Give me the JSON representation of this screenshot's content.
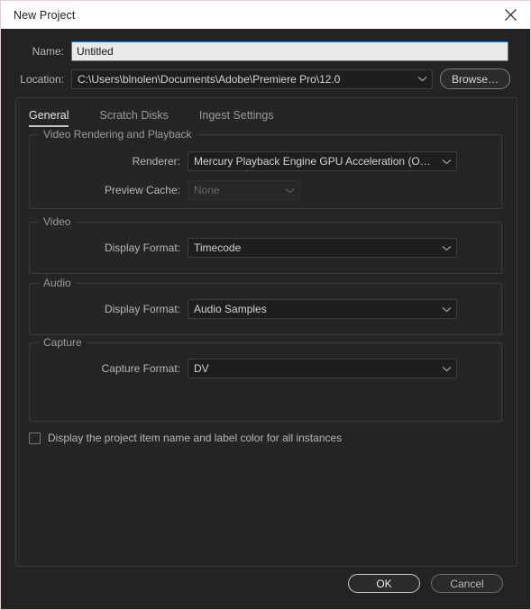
{
  "window": {
    "title": "New Project",
    "close_icon": "close-icon",
    "border_color": "#e3cfcf",
    "titlebar_bg": "#ffffff",
    "body_bg": "#232323",
    "panel_bg": "#252525",
    "accent_focus": "#2f7fd0"
  },
  "form": {
    "name": {
      "label": "Name:",
      "value": "Untitled",
      "placeholder": "Untitled"
    },
    "location": {
      "label": "Location:",
      "value": "C:\\Users\\blnolen\\Documents\\Adobe\\Premiere Pro\\12.0",
      "chevron_icon": "chevron-down-icon"
    },
    "browse": {
      "label": "Browse…"
    }
  },
  "tabs": [
    {
      "label": "General",
      "active": true
    },
    {
      "label": "Scratch Disks",
      "active": false
    },
    {
      "label": "Ingest Settings",
      "active": false
    }
  ],
  "groups": {
    "rendering": {
      "title": "Video Rendering and Playback",
      "renderer": {
        "label": "Renderer:",
        "value": "Mercury Playback Engine GPU Acceleration (OpenCL)",
        "chevron_icon": "chevron-down-icon"
      },
      "preview_cache": {
        "label": "Preview Cache:",
        "value": "None",
        "disabled": true,
        "chevron_icon": "chevron-down-icon"
      }
    },
    "video": {
      "title": "Video",
      "display_format": {
        "label": "Display Format:",
        "value": "Timecode",
        "chevron_icon": "chevron-down-icon"
      }
    },
    "audio": {
      "title": "Audio",
      "display_format": {
        "label": "Display Format:",
        "value": "Audio Samples",
        "chevron_icon": "chevron-down-icon"
      }
    },
    "capture": {
      "title": "Capture",
      "capture_format": {
        "label": "Capture Format:",
        "value": "DV",
        "chevron_icon": "chevron-down-icon"
      }
    }
  },
  "checkbox": {
    "label": "Display the project item name and label color for all instances",
    "checked": false
  },
  "footer": {
    "ok_label": "OK",
    "cancel_label": "Cancel"
  }
}
